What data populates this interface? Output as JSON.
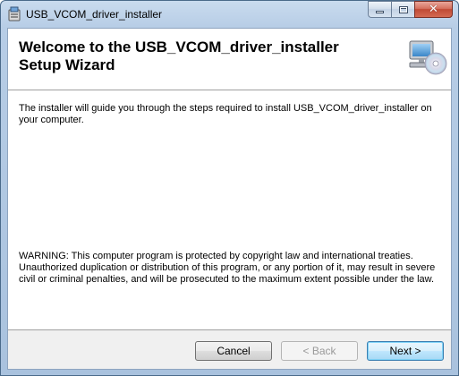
{
  "window": {
    "title": "USB_VCOM_driver_installer",
    "app_icon": "installer-package-icon"
  },
  "caption_buttons": {
    "minimize_icon": "minimize-icon",
    "maximize_icon": "maximize-icon",
    "close_glyph": "✕"
  },
  "banner": {
    "title": "Welcome to the USB_VCOM_driver_installer Setup Wizard",
    "graphic": "computer-with-cd-icon"
  },
  "body": {
    "intro": "The installer will guide you through the steps required to install USB_VCOM_driver_installer on your computer.",
    "warning": "WARNING: This computer program is protected by copyright law and international treaties. Unauthorized duplication or distribution of this program, or any portion of it, may result in severe civil or criminal penalties, and will be prosecuted to the maximum extent possible under the law."
  },
  "buttons": {
    "cancel": "Cancel",
    "back": "< Back",
    "next": "Next >",
    "back_enabled": false
  },
  "colors": {
    "titlebar": "#b7cde6",
    "close_button": "#c04a35",
    "default_button_border": "#3c7fb1"
  }
}
